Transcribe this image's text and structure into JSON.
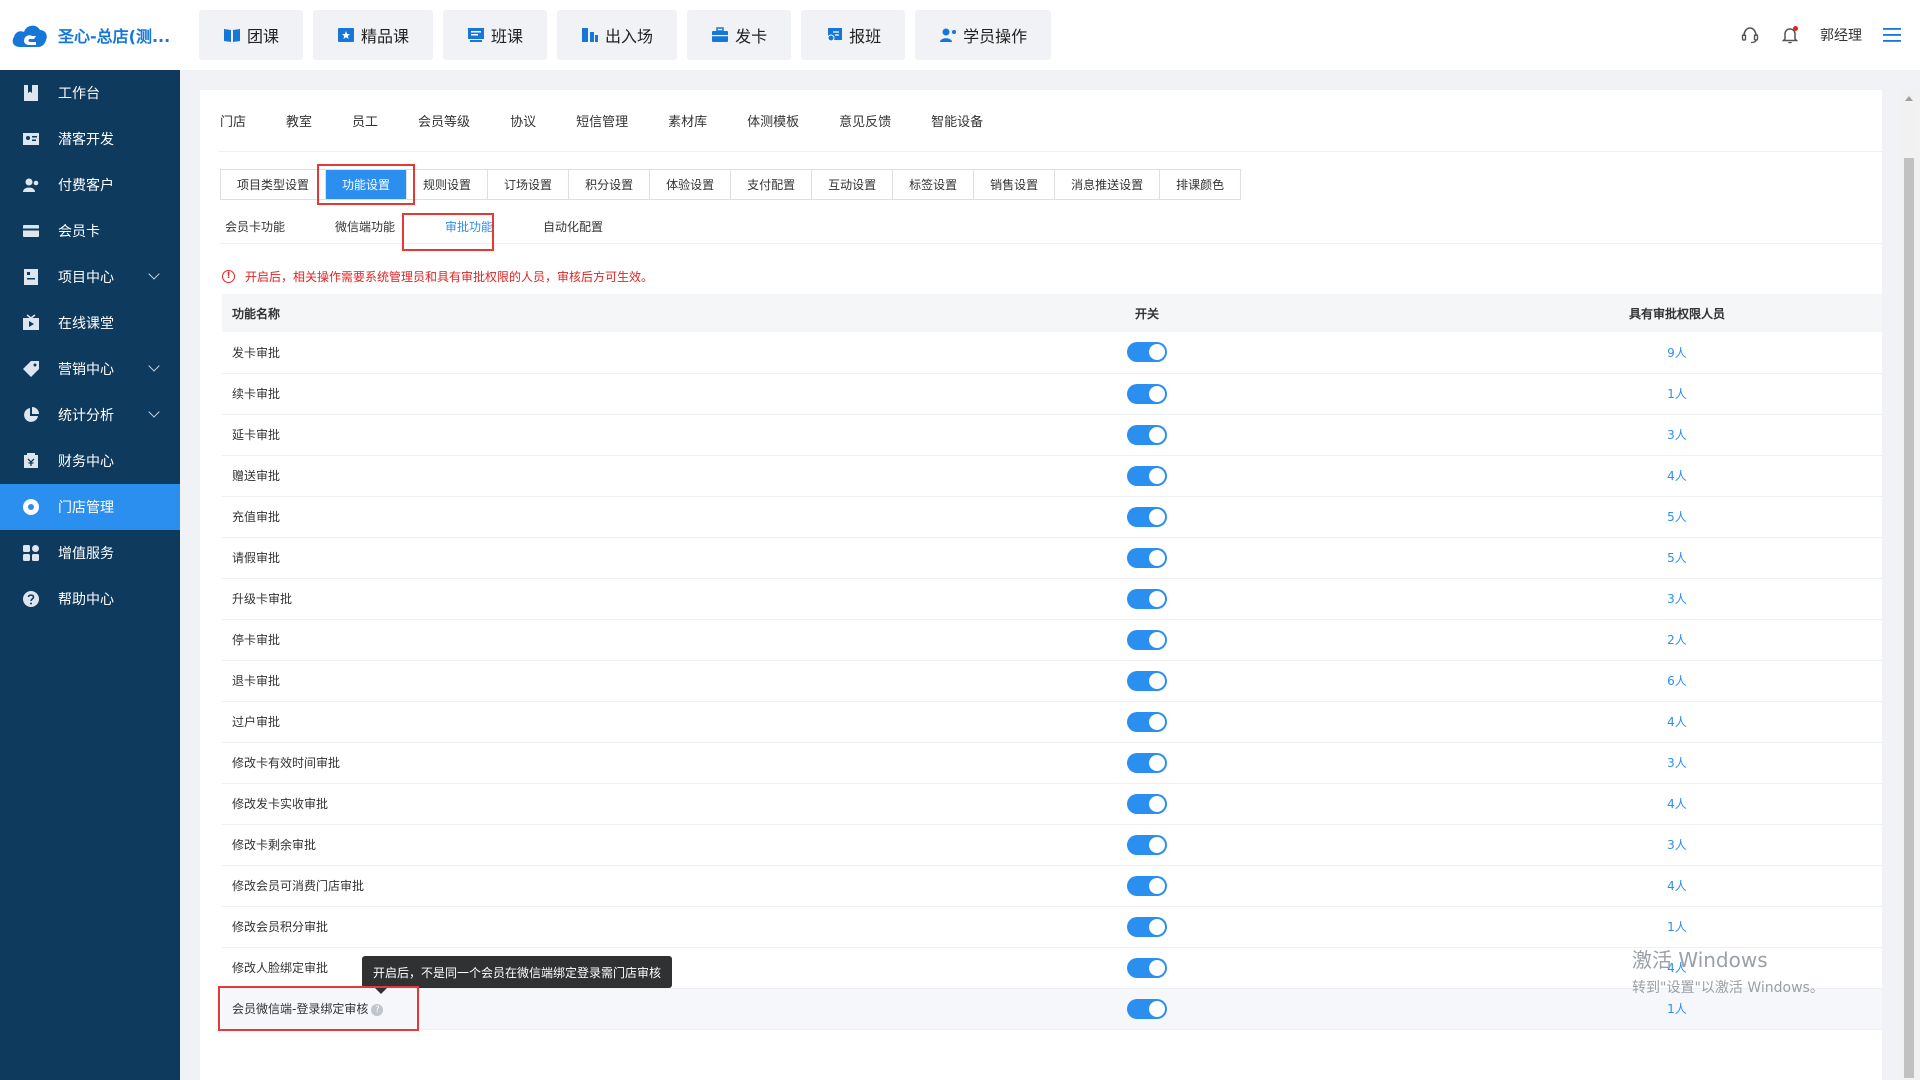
{
  "brand": {
    "name": "圣心-总店(测...",
    "color": "#1677d9"
  },
  "quick_nav": [
    {
      "label": "团课",
      "icon": "book-icon"
    },
    {
      "label": "精品课",
      "icon": "star-card-icon"
    },
    {
      "label": "班课",
      "icon": "class-board-icon"
    },
    {
      "label": "出入场",
      "icon": "gate-icon"
    },
    {
      "label": "发卡",
      "icon": "briefcase-icon"
    },
    {
      "label": "报班",
      "icon": "signup-icon"
    },
    {
      "label": "学员操作",
      "icon": "user-gear-icon"
    }
  ],
  "top_right": {
    "user_name": "郭经理"
  },
  "sidebar": {
    "items": [
      {
        "label": "工作台",
        "icon": "bookmark-icon",
        "arrow": false,
        "active": false
      },
      {
        "label": "潜客开发",
        "icon": "id-card-icon",
        "arrow": false,
        "active": false
      },
      {
        "label": "付费客户",
        "icon": "users-icon",
        "arrow": false,
        "active": false
      },
      {
        "label": "会员卡",
        "icon": "card-icon",
        "arrow": false,
        "active": false
      },
      {
        "label": "项目中心",
        "icon": "project-icon",
        "arrow": true,
        "active": false
      },
      {
        "label": "在线课堂",
        "icon": "tv-icon",
        "arrow": false,
        "active": false
      },
      {
        "label": "营销中心",
        "icon": "tag-icon",
        "arrow": true,
        "active": false
      },
      {
        "label": "统计分析",
        "icon": "pie-chart-icon",
        "arrow": true,
        "active": false
      },
      {
        "label": "财务中心",
        "icon": "finance-icon",
        "arrow": false,
        "active": false
      },
      {
        "label": "门店管理",
        "icon": "store-icon",
        "arrow": false,
        "active": true
      },
      {
        "label": "增值服务",
        "icon": "grid-icon",
        "arrow": false,
        "active": false
      },
      {
        "label": "帮助中心",
        "icon": "help-icon",
        "arrow": false,
        "active": false
      }
    ],
    "bg_color": "#0e3a5e",
    "active_color": "#2b8ff0"
  },
  "store_tabs": [
    "门店",
    "教室",
    "员工",
    "会员等级",
    "协议",
    "短信管理",
    "素材库",
    "体测模板",
    "意见反馈",
    "智能设备"
  ],
  "func_tabs": [
    {
      "label": "项目类型设置",
      "active": false
    },
    {
      "label": "功能设置",
      "active": true
    },
    {
      "label": "规则设置",
      "active": false
    },
    {
      "label": "订场设置",
      "active": false
    },
    {
      "label": "积分设置",
      "active": false
    },
    {
      "label": "体验设置",
      "active": false
    },
    {
      "label": "支付配置",
      "active": false
    },
    {
      "label": "互动设置",
      "active": false
    },
    {
      "label": "标签设置",
      "active": false
    },
    {
      "label": "销售设置",
      "active": false
    },
    {
      "label": "消息推送设置",
      "active": false
    },
    {
      "label": "排课颜色",
      "active": false
    }
  ],
  "sub_tabs": [
    {
      "label": "会员卡功能",
      "active": false
    },
    {
      "label": "微信端功能",
      "active": false
    },
    {
      "label": "审批功能",
      "active": true
    },
    {
      "label": "自动化配置",
      "active": false
    }
  ],
  "notice": {
    "icon": "!",
    "text": "开启后，相关操作需要系统管理员和具有审批权限的人员，审核后方可生效。"
  },
  "table": {
    "headers": [
      "功能名称",
      "开关",
      "具有审批权限人员"
    ],
    "rows": [
      {
        "name": "发卡审批",
        "enabled": true,
        "count": "9人"
      },
      {
        "name": "续卡审批",
        "enabled": true,
        "count": "1人"
      },
      {
        "name": "延卡审批",
        "enabled": true,
        "count": "3人"
      },
      {
        "name": "赠送审批",
        "enabled": true,
        "count": "4人"
      },
      {
        "name": "充值审批",
        "enabled": true,
        "count": "5人"
      },
      {
        "name": "请假审批",
        "enabled": true,
        "count": "5人"
      },
      {
        "name": "升级卡审批",
        "enabled": true,
        "count": "3人"
      },
      {
        "name": "停卡审批",
        "enabled": true,
        "count": "2人"
      },
      {
        "name": "退卡审批",
        "enabled": true,
        "count": "6人"
      },
      {
        "name": "过户审批",
        "enabled": true,
        "count": "4人"
      },
      {
        "name": "修改卡有效时间审批",
        "enabled": true,
        "count": "3人"
      },
      {
        "name": "修改发卡实收审批",
        "enabled": true,
        "count": "4人"
      },
      {
        "name": "修改卡剩余审批",
        "enabled": true,
        "count": "3人"
      },
      {
        "name": "修改会员可消费门店审批",
        "enabled": true,
        "count": "4人"
      },
      {
        "name": "修改会员积分审批",
        "enabled": true,
        "count": "1人"
      },
      {
        "name": "修改人脸绑定审批",
        "enabled": true,
        "count": "4人"
      },
      {
        "name": "会员微信端-登录绑定审核",
        "enabled": true,
        "count": "1人",
        "help": "?"
      }
    ]
  },
  "tooltip": {
    "text": "开启后，不是同一个会员在微信端绑定登录需门店审核"
  },
  "watermark": {
    "line1": "激活 Windows",
    "line2": "转到\"设置\"以激活 Windows。"
  },
  "colors": {
    "accent": "#2b8ff0",
    "danger": "#e02424",
    "highlight_box": "#e53935"
  }
}
